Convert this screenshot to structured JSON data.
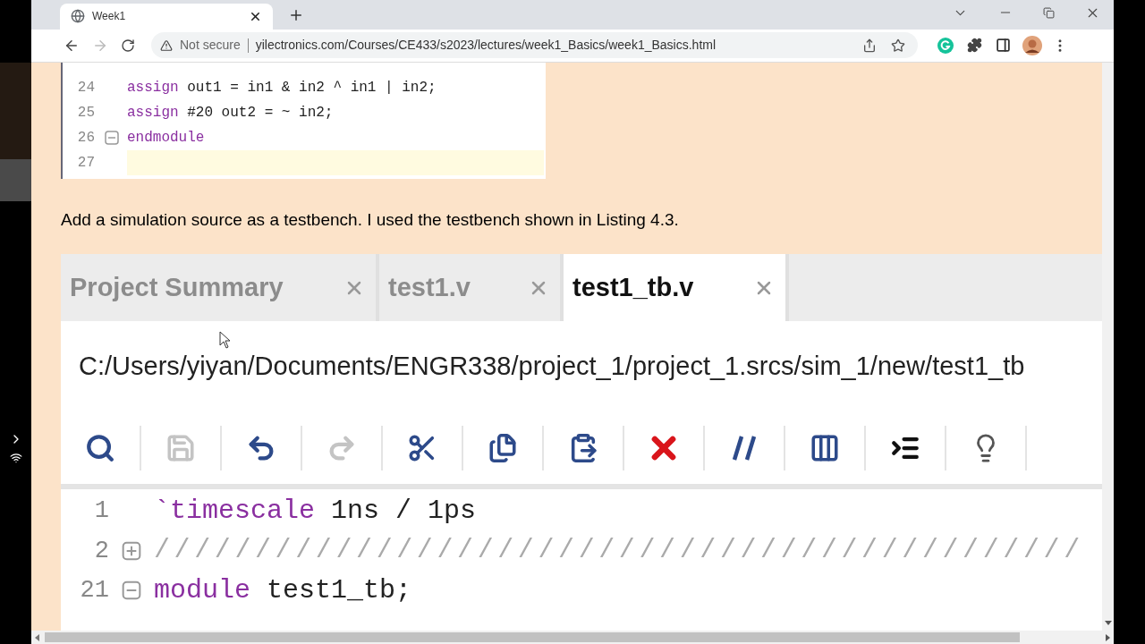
{
  "browser": {
    "tab": {
      "title": "Week1",
      "selected": true
    },
    "address": {
      "security": "Not secure",
      "url": "yilectronics.com/Courses/CE433/s2023/lectures/week1_Basics/week1_Basics.html"
    },
    "forward_disabled": true
  },
  "page": {
    "code_listing": [
      {
        "number": "24",
        "kind": "plain",
        "current": false,
        "tokens": [
          {
            "text": "assign",
            "kind": "keyword"
          },
          {
            "text": " out1 = in1 & in2 ^ in1 | in2;",
            "kind": "plain"
          }
        ]
      },
      {
        "number": "25",
        "kind": "plain",
        "current": false,
        "tokens": [
          {
            "text": "assign",
            "kind": "keyword"
          },
          {
            "text": " #20 out2 = ~ in2;",
            "kind": "plain"
          }
        ]
      },
      {
        "number": "26",
        "kind": "collapsible",
        "current": false,
        "tokens": [
          {
            "text": "endmodule",
            "kind": "keyword"
          }
        ]
      },
      {
        "number": "27",
        "kind": "plain",
        "current": true
      }
    ],
    "paragraph": "Add a simulation source as a testbench. I used the testbench shown in Listing 4.3.",
    "editor": {
      "tabs": [
        {
          "label": "Project Summary",
          "selected": false
        },
        {
          "label": "test1.v",
          "selected": false
        },
        {
          "label": "test1_tb.v",
          "selected": true
        }
      ],
      "path": "C:/Users/yiyan/Documents/ENGR338/project_1/project_1.srcs/sim_1/new/test1_tb",
      "toolbar": [
        {
          "disabled": false
        },
        {
          "disabled": true
        },
        {
          "disabled": false
        },
        {
          "disabled": true
        },
        {
          "disabled": false
        },
        {
          "disabled": false
        },
        {
          "disabled": false
        },
        {
          "disabled": false
        },
        {
          "disabled": false
        },
        {
          "disabled": false
        },
        {
          "disabled": false
        },
        {
          "disabled": false
        }
      ],
      "lines": [
        {
          "number": "1",
          "kind": "plain",
          "tokens": [
            {
              "text": "`timescale",
              "kind": "keyword"
            },
            {
              "text": " 1ns / 1ps",
              "kind": "plain"
            }
          ]
        },
        {
          "number": "2",
          "kind": "expandable",
          "tokens": [
            {
              "text": "//////////////////////////////////////////////",
              "kind": "comment"
            }
          ]
        },
        {
          "number": "21",
          "kind": "collapsible",
          "tokens": [
            {
              "text": "module",
              "kind": "keyword"
            },
            {
              "text": " test1_tb;",
              "kind": "plain"
            }
          ]
        }
      ]
    }
  }
}
